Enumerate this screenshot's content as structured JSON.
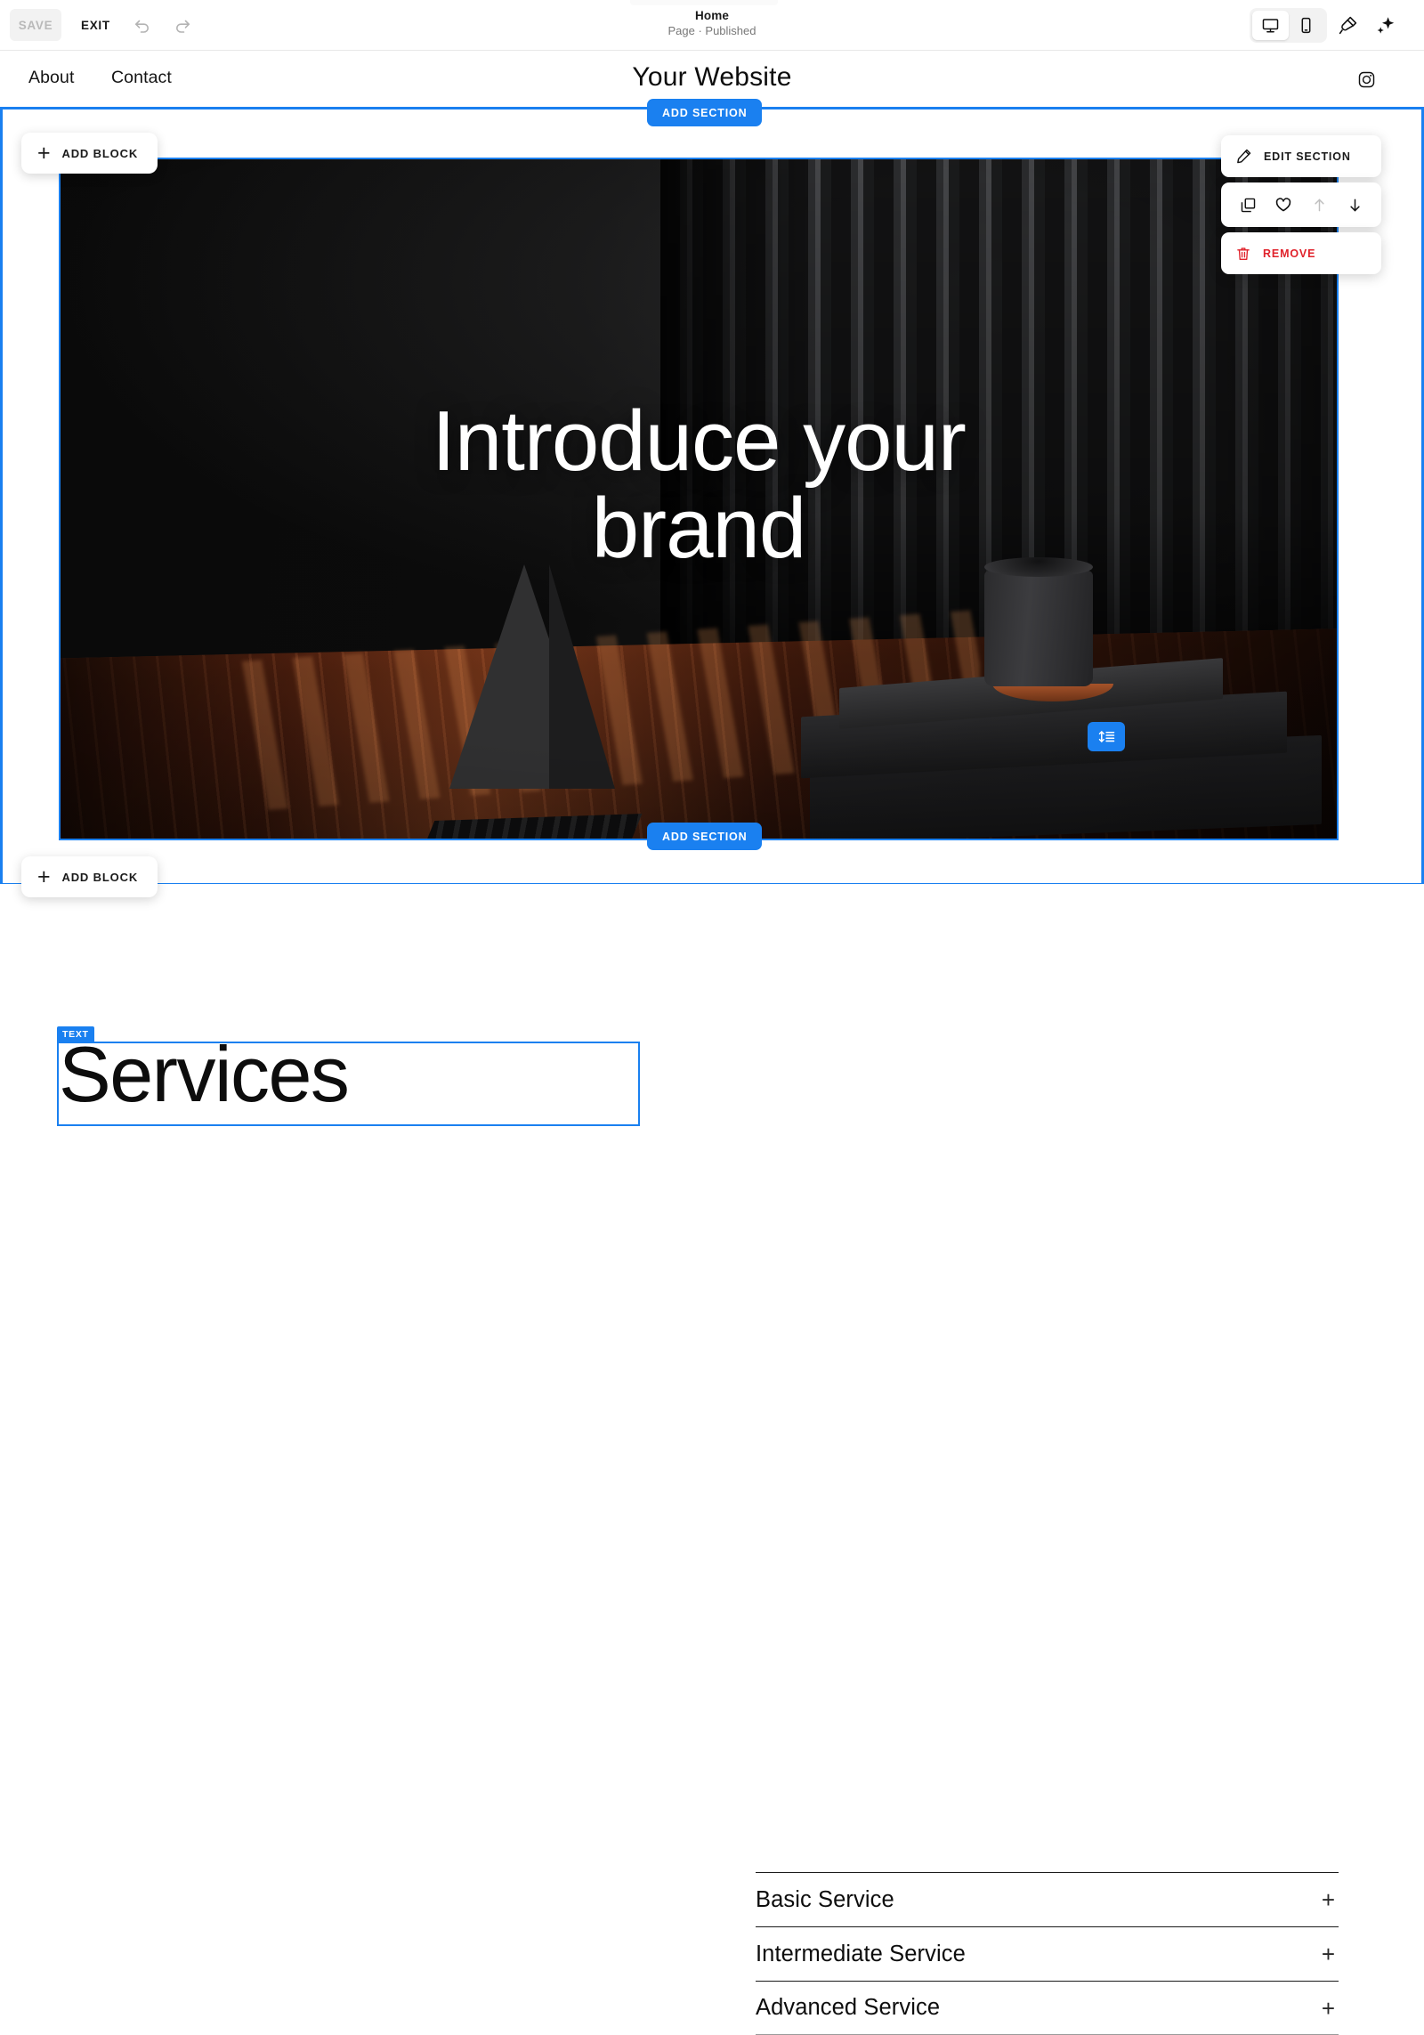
{
  "editor": {
    "save_label": "SAVE",
    "exit_label": "EXIT",
    "undo_icon": "undo-arrow-icon",
    "redo_icon": "redo-arrow-icon",
    "page_title": "Home",
    "page_status": "Page · Published",
    "device_desktop_icon": "desktop-monitor-icon",
    "device_mobile_icon": "mobile-phone-icon",
    "device_selected": "desktop",
    "brush_icon": "paintbrush-icon",
    "magic_icon": "sparkles-icon",
    "accent_color": "#1a80f0",
    "danger_color": "#e0222b"
  },
  "site_nav": {
    "about_label": "About",
    "contact_label": "Contact",
    "logo_label": "Your Website",
    "instagram_icon": "instagram-icon"
  },
  "overlays": {
    "add_section_label": "ADD SECTION",
    "add_block_label": "ADD BLOCK",
    "text_badge_label": "TEXT",
    "resize_icon": "resize-height-icon"
  },
  "section_toolbar": {
    "edit_label": "EDIT SECTION",
    "edit_icon": "pencil-icon",
    "duplicate_icon": "duplicate-icon",
    "favorite_icon": "heart-icon",
    "move_up_icon": "arrow-up-icon",
    "move_up_disabled": true,
    "move_down_icon": "arrow-down-icon",
    "remove_label": "REMOVE",
    "remove_icon": "trash-icon"
  },
  "hero": {
    "headline_line1": "Introduce your",
    "headline_line2": "brand"
  },
  "services": {
    "title": "Services",
    "items": [
      {
        "label": "Basic Service",
        "toggle": "+"
      },
      {
        "label": "Intermediate Service",
        "toggle": "+"
      },
      {
        "label": "Advanced Service",
        "toggle": "+"
      }
    ]
  }
}
